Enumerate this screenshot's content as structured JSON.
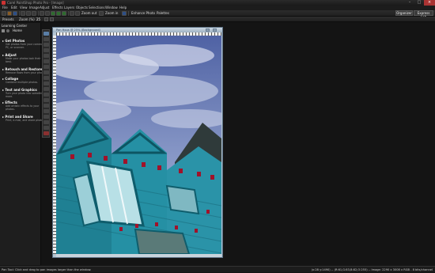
{
  "titlebar": {
    "title": "Corel PaintShop Photo Pro - [Image]"
  },
  "menu": [
    "File",
    "Edit",
    "View",
    "Image",
    "Adjust",
    "Effects",
    "Layers",
    "Objects",
    "Selections",
    "Window",
    "Help"
  ],
  "toolbar": {
    "zoom_out": "Zoom out",
    "zoom_in": "Zoom in",
    "enhance_photo": "Enhance Photo",
    "palettes": "Palettes",
    "organizer": "Organizer",
    "express_lab": "Express Lab"
  },
  "toolbar2": {
    "presets": "Presets",
    "zoom_label": "Zoom (%)",
    "zoom_value": "25"
  },
  "learning_center": {
    "title": "Learning Center",
    "crumb": "Home",
    "sections": [
      {
        "title": "Get Photos",
        "desc": [
          "Get photos from your camera,",
          "PC, or scanner."
        ]
      },
      {
        "title": "Adjust",
        "desc": [
          "Make your photos look their",
          "best."
        ]
      },
      {
        "title": "Retouch and Restore",
        "desc": [
          "Remove flaws from your photos."
        ]
      },
      {
        "title": "Collage",
        "desc": [
          "Combine multiple photos."
        ]
      },
      {
        "title": "Text and Graphics",
        "desc": [
          "Turn your photo into something",
          "more."
        ]
      },
      {
        "title": "Effects",
        "desc": [
          "Add artistic effects to your",
          "photos."
        ]
      },
      {
        "title": "Print and Share",
        "desc": [
          "Print, e-mail, and share photos."
        ]
      }
    ]
  },
  "image_window": {
    "title": "Pan Hous @ 25% (Background)"
  },
  "status": {
    "left": "Pan Tool: Click and drag to pan images larger than the window.",
    "right": "(x:28 y:1490) -- (R:61,G:83,B:82,O:255) -- Image: 2290 x 3008 x RGB - 8 bits/channel"
  },
  "colors": {
    "sky": "#6d7fb3",
    "siding": "#2a8c9f",
    "trim": "#a0122a"
  }
}
